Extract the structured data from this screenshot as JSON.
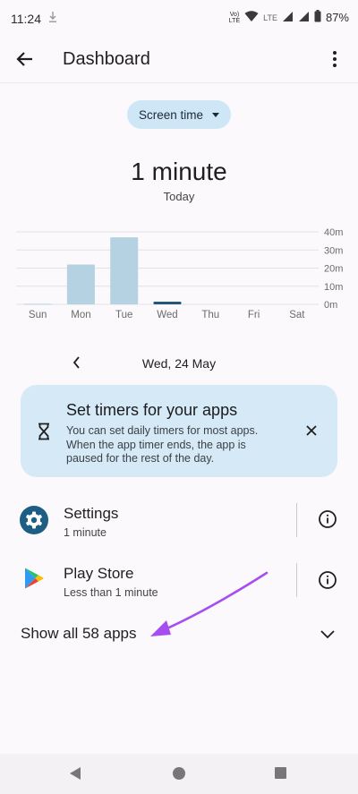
{
  "status_bar": {
    "time": "11:24",
    "network": "Vo) LTE",
    "network_top": "Vo)",
    "network_bottom": "LTE",
    "lte": "LTE",
    "battery": "87%"
  },
  "app_bar": {
    "title": "Dashboard",
    "back_icon": "arrow-left-icon",
    "menu_icon": "more-vert-icon"
  },
  "filter_chip": {
    "label": "Screen time"
  },
  "summary": {
    "total": "1 minute",
    "period": "Today"
  },
  "chart_data": {
    "type": "bar",
    "categories": [
      "Sun",
      "Mon",
      "Tue",
      "Wed",
      "Thu",
      "Fri",
      "Sat"
    ],
    "values": [
      0.3,
      22,
      37,
      1.5,
      0,
      0,
      0
    ],
    "selected": "Wed",
    "y_ticks": [
      "40m",
      "30m",
      "20m",
      "10m",
      "0m"
    ],
    "ylim": [
      0,
      40
    ],
    "colors": {
      "bar": "#b4d2e1",
      "selected": "#21577a",
      "grid": "#e2e2e6"
    }
  },
  "date_nav": {
    "label": "Wed, 24 May",
    "prev_icon": "chevron-left-icon"
  },
  "timer_card": {
    "title": "Set timers for your apps",
    "text": "You can set daily timers for most apps. When the app timer ends, the app is paused for the rest of the day.",
    "icon": "hourglass-icon",
    "close_icon": "close-icon"
  },
  "apps": [
    {
      "name": "Settings",
      "usage": "1 minute",
      "icon": "settings-gear-icon"
    },
    {
      "name": "Play Store",
      "usage": "Less than 1 minute",
      "icon": "play-store-icon"
    }
  ],
  "show_all": {
    "label": "Show all 58 apps"
  },
  "colors": {
    "accent_arrow": "#a64df0",
    "chip_bg": "#cfe6f7",
    "card_bg": "#d5e9f7"
  }
}
